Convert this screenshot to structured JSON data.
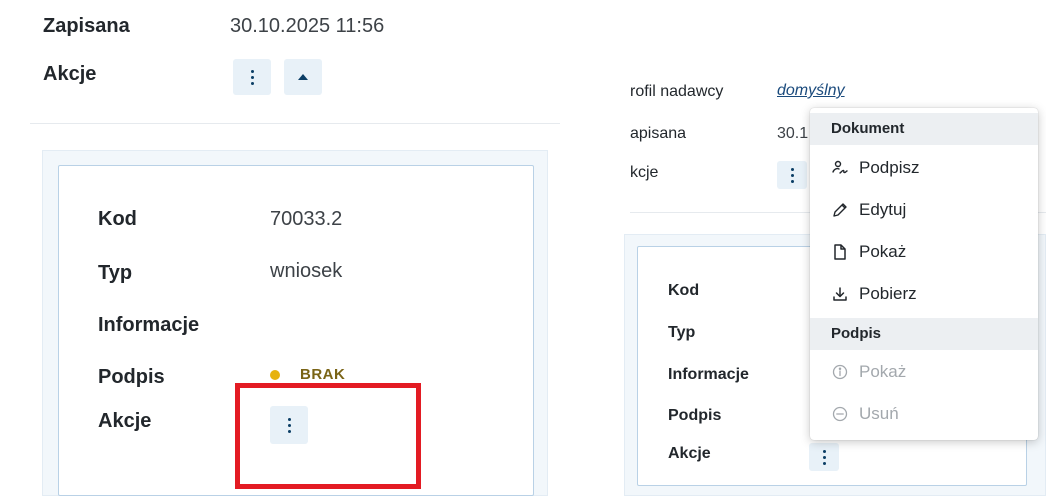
{
  "left": {
    "header": {
      "saved_label": "Zapisana",
      "saved_value": "30.10.2025 11:56",
      "actions_label": "Akcje"
    },
    "card": {
      "code_label": "Kod",
      "code_value": "70033.2",
      "type_label": "Typ",
      "type_value": "wniosek",
      "info_label": "Informacje",
      "info_value": "",
      "signature_label": "Podpis",
      "signature_status": "BRAK",
      "actions_label": "Akcje"
    }
  },
  "right": {
    "header": {
      "sender_profile_label": "rofil nadawcy",
      "sender_profile_value": "domyślny",
      "saved_label": "apisana",
      "saved_value_partial": "30.1",
      "actions_label": "kcje"
    },
    "card": {
      "code_label": "Kod",
      "type_label": "Typ",
      "info_label": "Informacje",
      "signature_label": "Podpis",
      "actions_label": "Akcje"
    },
    "menu": {
      "section_document": "Dokument",
      "sign": "Podpisz",
      "edit": "Edytuj",
      "show": "Pokaż",
      "download": "Pobierz",
      "section_signature": "Podpis",
      "signature_show": "Pokaż",
      "signature_remove": "Usuń"
    }
  },
  "colors": {
    "accent_dark": "#0b3e66",
    "status_warning": "#e7b20d",
    "highlight_red": "#e31b23",
    "link": "#1a4a7c"
  },
  "icons": {
    "sign": "signature-icon",
    "edit": "pencil-icon",
    "show": "document-icon",
    "download": "download-icon",
    "info": "info-circle-icon",
    "remove": "minus-circle-icon"
  }
}
